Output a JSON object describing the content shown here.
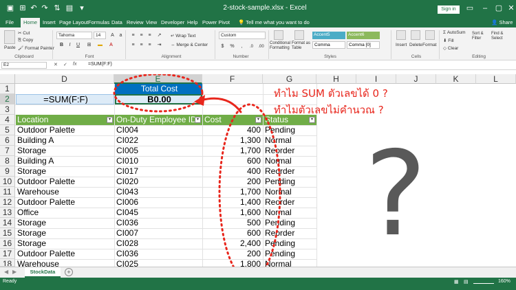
{
  "window": {
    "title": "2-stock-sample.xlsx - Excel",
    "sign_in": "Sign in",
    "share": "Share"
  },
  "menu": {
    "tabs": [
      "File",
      "Home",
      "Insert",
      "Page Layout",
      "Formulas",
      "Data",
      "Review",
      "View",
      "Developer",
      "Help",
      "Power Pivot"
    ],
    "active": "Home",
    "tell_me": "Tell me what you want to do"
  },
  "ribbon": {
    "clipboard": {
      "paste": "Paste",
      "cut": "Cut",
      "copy": "Copy",
      "format_painter": "Format Painter",
      "label": "Clipboard"
    },
    "font": {
      "name": "Tahoma",
      "size": "14",
      "label": "Font"
    },
    "alignment": {
      "wrap": "Wrap Text",
      "merge": "Merge & Center",
      "label": "Alignment"
    },
    "number": {
      "format": "Custom",
      "label": "Number"
    },
    "styles": {
      "conditional": "Conditional Formatting",
      "format_table": "Format as Table",
      "accent5": "Accent5",
      "accent6": "Accent6",
      "comma": "Comma",
      "comma0": "Comma [0]",
      "label": "Styles"
    },
    "cells": {
      "insert": "Insert",
      "delete": "Delete",
      "format": "Format",
      "label": "Cells"
    },
    "editing": {
      "autosum": "AutoSum",
      "fill": "Fill",
      "clear": "Clear",
      "sort": "Sort & Filter",
      "find": "Find & Select",
      "label": "Editing"
    }
  },
  "formula_bar": {
    "name_box": "E2",
    "formula": "=SUM(F:F)"
  },
  "columns": [
    "D",
    "E",
    "F",
    "G",
    "H",
    "I",
    "J",
    "K",
    "L"
  ],
  "rows": [
    "1",
    "2",
    "3",
    "4",
    "5",
    "6",
    "7",
    "8",
    "9",
    "10",
    "11",
    "12",
    "13",
    "14",
    "15",
    "16",
    "17",
    "18"
  ],
  "cells": {
    "formula_label": "=SUM(F:F)",
    "total_header": "Total Cost",
    "total_value": "B0.00",
    "headers": [
      "Location",
      "On-Duty Employee ID",
      "Cost",
      "Status"
    ],
    "data": [
      [
        "Outdoor Palette",
        "CI004",
        "400",
        "Pending"
      ],
      [
        "Building A",
        "CI022",
        "1,300",
        "Normal"
      ],
      [
        "Storage",
        "CI005",
        "1,700",
        "Reorder"
      ],
      [
        "Building A",
        "CI010",
        "600",
        "Normal"
      ],
      [
        "Storage",
        "CI017",
        "400",
        "Reorder"
      ],
      [
        "Outdoor Palette",
        "CI020",
        "200",
        "Pending"
      ],
      [
        "Warehouse",
        "CI043",
        "1,700",
        "Normal"
      ],
      [
        "Outdoor Palette",
        "CI006",
        "1,400",
        "Reorder"
      ],
      [
        "Office",
        "CI045",
        "1,600",
        "Normal"
      ],
      [
        "Storage",
        "CI036",
        "500",
        "Pending"
      ],
      [
        "Storage",
        "CI007",
        "600",
        "Reorder"
      ],
      [
        "Storage",
        "CI028",
        "2,400",
        "Pending"
      ],
      [
        "Outdoor Palette",
        "CI036",
        "200",
        "Pending"
      ],
      [
        "Warehouse",
        "CI025",
        "1,800",
        "Normal"
      ]
    ]
  },
  "annotation": {
    "line1": "ทำไม SUM ตัวเลขได้ 0 ?",
    "line2": "ทำไมตัวเลขไม่คำนวณ ?",
    "big_mark": "?"
  },
  "sheet": {
    "tab": "StockData"
  },
  "status": {
    "ready": "Ready",
    "zoom": "160%"
  },
  "colors": {
    "excel_green": "#217346",
    "table_header": "#70ad47",
    "highlight_blue": "#0070c0",
    "cell_fill": "#ddebf7",
    "annotation_red": "#e8261c"
  }
}
